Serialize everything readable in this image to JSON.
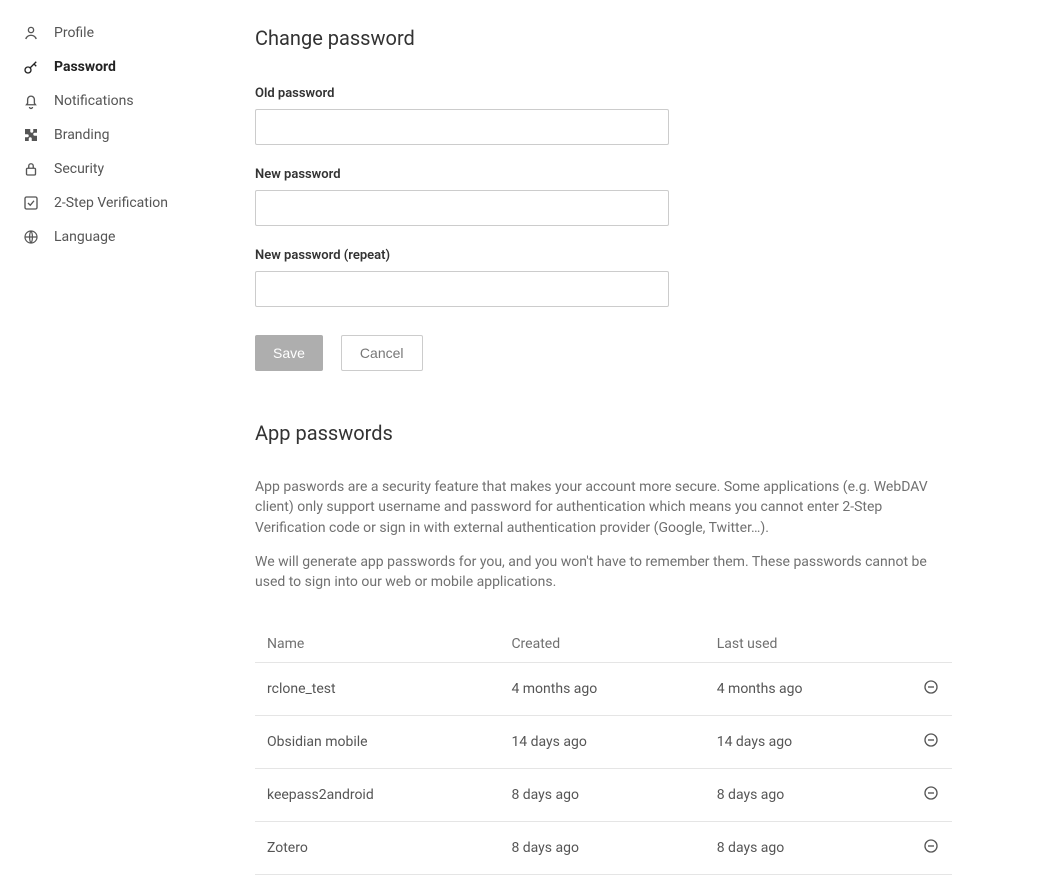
{
  "sidebar": {
    "items": [
      {
        "label": "Profile"
      },
      {
        "label": "Password"
      },
      {
        "label": "Notifications"
      },
      {
        "label": "Branding"
      },
      {
        "label": "Security"
      },
      {
        "label": "2-Step Verification"
      },
      {
        "label": "Language"
      }
    ],
    "active_index": 1
  },
  "change_password": {
    "heading": "Change password",
    "old_label": "Old password",
    "new_label": "New password",
    "repeat_label": "New password (repeat)",
    "old_value": "",
    "new_value": "",
    "repeat_value": "",
    "save_label": "Save",
    "cancel_label": "Cancel"
  },
  "app_passwords": {
    "heading": "App passwords",
    "desc1": "App paswords are a security feature that makes your account more secure. Some applications (e.g. WebDAV client) only support username and password for authentication which means you cannot enter 2-Step Verification code or sign in with external authentication provider (Google, Twitter…).",
    "desc2": "We will generate app passwords for you, and you won't have to remember them. These passwords cannot be used to sign into our web or mobile applications.",
    "columns": {
      "name": "Name",
      "created": "Created",
      "last_used": "Last used"
    },
    "rows": [
      {
        "name": "rclone_test",
        "created": "4 months ago",
        "last_used": "4 months ago"
      },
      {
        "name": "Obsidian mobile",
        "created": "14 days ago",
        "last_used": "14 days ago"
      },
      {
        "name": "keepass2android",
        "created": "8 days ago",
        "last_used": "8 days ago"
      },
      {
        "name": "Zotero",
        "created": "8 days ago",
        "last_used": "8 days ago"
      }
    ]
  }
}
